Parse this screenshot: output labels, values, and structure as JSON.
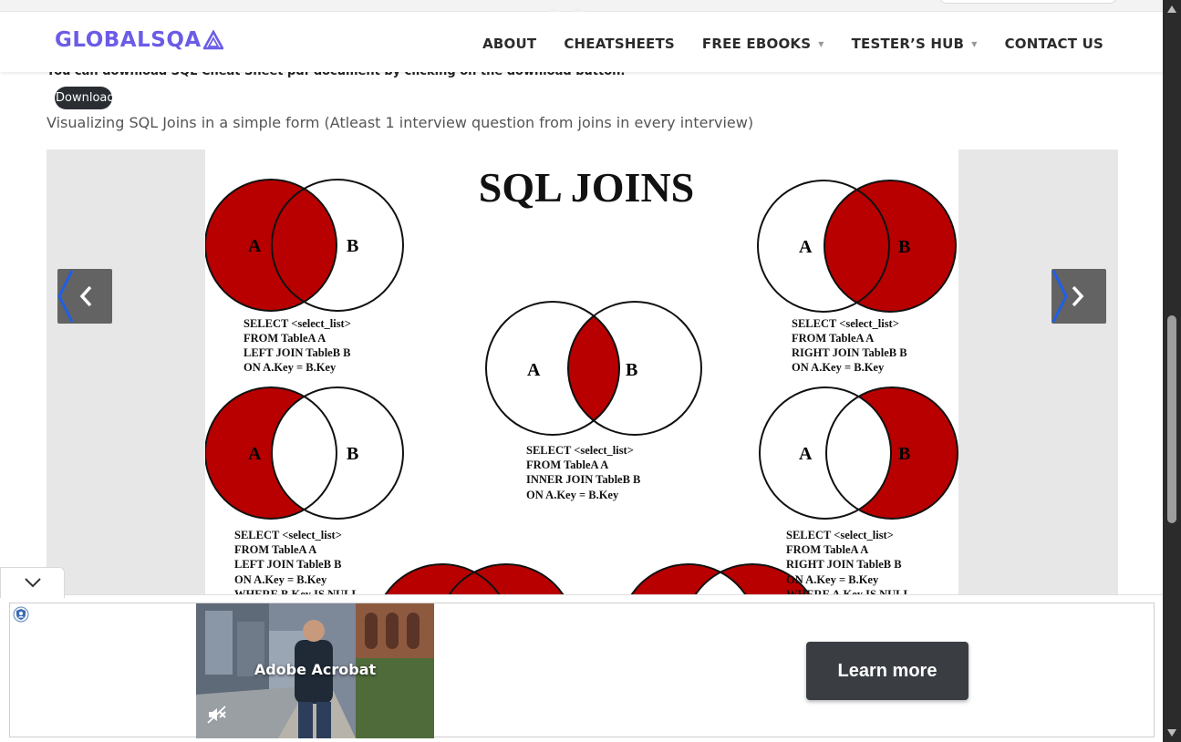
{
  "header": {
    "logo_text": "GLOBALSQA",
    "brand_color": "#6b5ce7",
    "nav": [
      {
        "label": "ABOUT",
        "has_dropdown": false
      },
      {
        "label": "CHEATSHEETS",
        "has_dropdown": false
      },
      {
        "label": "FREE EBOOKS",
        "has_dropdown": true
      },
      {
        "label": "TESTER’S HUB",
        "has_dropdown": true
      },
      {
        "label": "CONTACT US",
        "has_dropdown": false
      }
    ]
  },
  "content": {
    "download_note": "You can download SQL Cheat Sheet pdf document by clicking on the download button:",
    "download_label": "Download",
    "intro": "Visualizing SQL Joins in a simple form (Atleast 1 interview question from joins in every interview)"
  },
  "slide": {
    "title": "SQL JOINS",
    "fill_color": "#b80000",
    "circle_a": "A",
    "circle_b": "B",
    "left_join": [
      "SELECT <select_list>",
      "FROM TableA A",
      "LEFT JOIN TableB B",
      "ON A.Key = B.Key"
    ],
    "right_join": [
      "SELECT <select_list>",
      "FROM TableA A",
      "RIGHT JOIN TableB B",
      "ON A.Key = B.Key"
    ],
    "inner_join": [
      "SELECT <select_list>",
      "FROM TableA A",
      "INNER JOIN TableB B",
      "ON A.Key = B.Key"
    ],
    "left_null": [
      "SELECT <select_list>",
      "FROM TableA A",
      "LEFT JOIN TableB B",
      "ON A.Key = B.Key",
      "WHERE B.Key IS NULL"
    ],
    "right_null": [
      "SELECT <select_list>",
      "FROM TableA A",
      "RIGHT JOIN TableB B",
      "ON A.Key = B.Key",
      "WHERE A.Key IS NULL"
    ]
  },
  "slider": {
    "prev_icon": "chevron-left-icon",
    "next_icon": "chevron-right-icon"
  },
  "ad": {
    "brand": "Adobe Acrobat",
    "cta": "Learn more",
    "privacy_icon": "shield-icon",
    "mute_icon": "muted-speaker-icon"
  }
}
